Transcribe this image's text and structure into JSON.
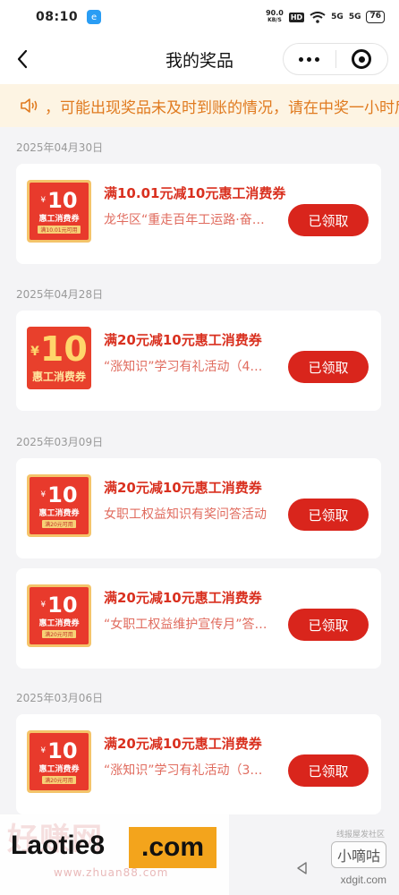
{
  "status_bar": {
    "time": "08:10",
    "net_speed_value": "90.0",
    "net_speed_unit": "KB/S",
    "hd_badge": "HD",
    "signal1": "5G",
    "signal2": "5G",
    "battery": "76"
  },
  "nav": {
    "title": "我的奖品"
  },
  "notice": {
    "text": "，可能出现奖品未及时到账的情况，请在中奖一小时后查看"
  },
  "sections": [
    {
      "date": "2025年04月30日",
      "items": [
        {
          "coupon": {
            "currency": "¥",
            "amount": "10",
            "name": "惠工消费券",
            "condition": "满10.01元可用"
          },
          "title": "满10.01元减10元惠工消费券",
          "source": "龙华区“重走百年工运路·奋…",
          "button": "已领取"
        }
      ]
    },
    {
      "date": "2025年04月28日",
      "items": [
        {
          "coupon": {
            "currency": "¥",
            "amount": "10",
            "name": "惠工消费券"
          },
          "title": "满20元减10元惠工消费券",
          "source": "“涨知识”学习有礼活动（4…",
          "button": "已领取"
        }
      ]
    },
    {
      "date": "2025年03月09日",
      "items": [
        {
          "coupon": {
            "currency": "¥",
            "amount": "10",
            "name": "惠工消费券",
            "condition": "满20元可用"
          },
          "title": "满20元减10元惠工消费券",
          "source": "女职工权益知识有奖问答活动",
          "button": "已领取"
        },
        {
          "coupon": {
            "currency": "¥",
            "amount": "10",
            "name": "惠工消费券",
            "condition": "满20元可用"
          },
          "title": "满20元减10元惠工消费券",
          "source": "“女职工权益维护宣传月”答…",
          "button": "已领取"
        }
      ]
    },
    {
      "date": "2025年03月06日",
      "items": [
        {
          "coupon": {
            "currency": "¥",
            "amount": "10",
            "name": "惠工消费券",
            "condition": "满20元可用"
          },
          "title": "满20元减10元惠工消费券",
          "source": "“涨知识”学习有礼活动（3…",
          "button": "已领取"
        }
      ]
    }
  ],
  "watermark": {
    "ghost_text": "好赚网",
    "ghost_sub": "www.zhuan88.com",
    "laotie": "Laotie8",
    "com": ".com",
    "right_label": "线报屋发社区",
    "xiaodigu": "小嘀咕",
    "domain": "xdgit.com"
  },
  "icons": [
    "back-arrow-icon",
    "more-dots-icon",
    "mini-program-close-icon",
    "speaker-icon",
    "app-notification-icon",
    "wifi-icon",
    "system-back-icon"
  ],
  "colors": {
    "accent_red": "#d9251c",
    "title_red": "#d9301f",
    "notice_orange": "#e07a1f",
    "notice_bg": "#fdf4e3"
  }
}
